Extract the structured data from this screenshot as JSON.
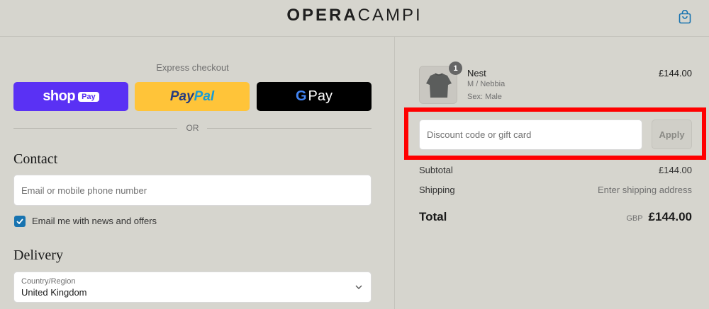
{
  "header": {
    "logo_bold": "OPERA",
    "logo_light": "CAMPI",
    "cart_icon": "shopping-bag-icon"
  },
  "express": {
    "title": "Express checkout",
    "shop_word": "shop",
    "shop_badge": "Pay",
    "paypal_1": "Pay",
    "paypal_2": "Pal",
    "gpay_g": "G",
    "gpay_word": "Pay",
    "or": "OR"
  },
  "contact": {
    "heading": "Contact",
    "email_placeholder": "Email or mobile phone number",
    "email_value": "",
    "newsletter_label": "Email me with news and offers",
    "newsletter_checked": true
  },
  "delivery": {
    "heading": "Delivery",
    "country_label": "Country/Region",
    "country_value": "United Kingdom"
  },
  "order": {
    "item": {
      "quantity": "1",
      "name": "Nest",
      "variant": "M / Nebbia",
      "sex": "Sex: Male",
      "price": "£144.00"
    },
    "discount_placeholder": "Discount code or gift card",
    "discount_value": "",
    "apply_label": "Apply",
    "subtotal_label": "Subtotal",
    "subtotal_value": "£144.00",
    "shipping_label": "Shipping",
    "shipping_value": "Enter shipping address",
    "total_label": "Total",
    "currency": "GBP",
    "total_value": "£144.00"
  },
  "colors": {
    "background": "#d6d5ce",
    "shop_pay": "#5a31f4",
    "paypal": "#ffc439",
    "gpay": "#000000",
    "checkbox": "#1773b0",
    "highlight": "#ff0000"
  }
}
